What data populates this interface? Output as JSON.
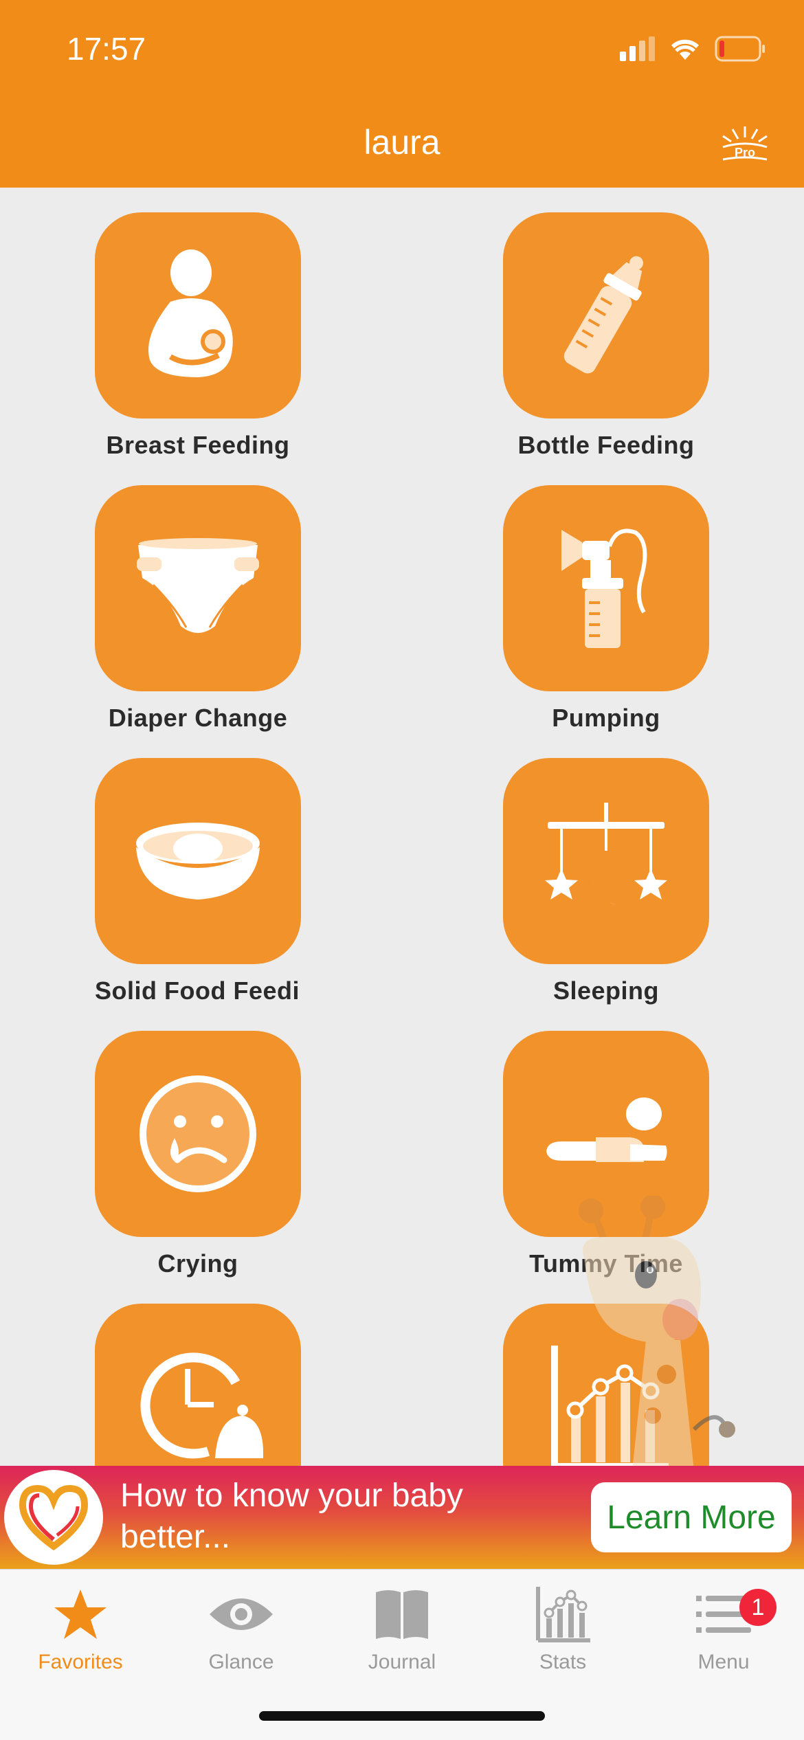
{
  "status_bar": {
    "time": "17:57"
  },
  "header": {
    "title": "laura",
    "pro_label": "Pro"
  },
  "tiles": [
    {
      "label": "Breast Feeding",
      "icon": "breastfeeding-icon"
    },
    {
      "label": "Bottle Feeding",
      "icon": "bottle-icon"
    },
    {
      "label": "Diaper Change",
      "icon": "diaper-icon"
    },
    {
      "label": "Pumping",
      "icon": "breast-pump-icon"
    },
    {
      "label": "Solid Food Feedir",
      "icon": "bowl-icon"
    },
    {
      "label": "Sleeping",
      "icon": "crib-mobile-icon"
    },
    {
      "label": "Crying",
      "icon": "crying-face-icon"
    },
    {
      "label": "Tummy Time",
      "icon": "tummy-time-icon"
    },
    {
      "label": "",
      "icon": "reminder-clock-bell-icon"
    },
    {
      "label": "",
      "icon": "growth-chart-icon"
    }
  ],
  "banner": {
    "text": "How to know your baby better...",
    "button": "Learn More",
    "icon": "heart-logo-icon"
  },
  "tabbar": {
    "items": [
      {
        "label": "Favorites",
        "icon": "star-icon",
        "active": true
      },
      {
        "label": "Glance",
        "icon": "eye-icon"
      },
      {
        "label": "Journal",
        "icon": "book-icon"
      },
      {
        "label": "Stats",
        "icon": "stats-icon"
      },
      {
        "label": "Menu",
        "icon": "menu-icon",
        "badge": "1"
      }
    ]
  },
  "colors": {
    "primary": "#f28c18",
    "tile": "#f2922b",
    "background": "#ececec",
    "button_text": "#1f8c2b",
    "badge": "#f0253a"
  }
}
